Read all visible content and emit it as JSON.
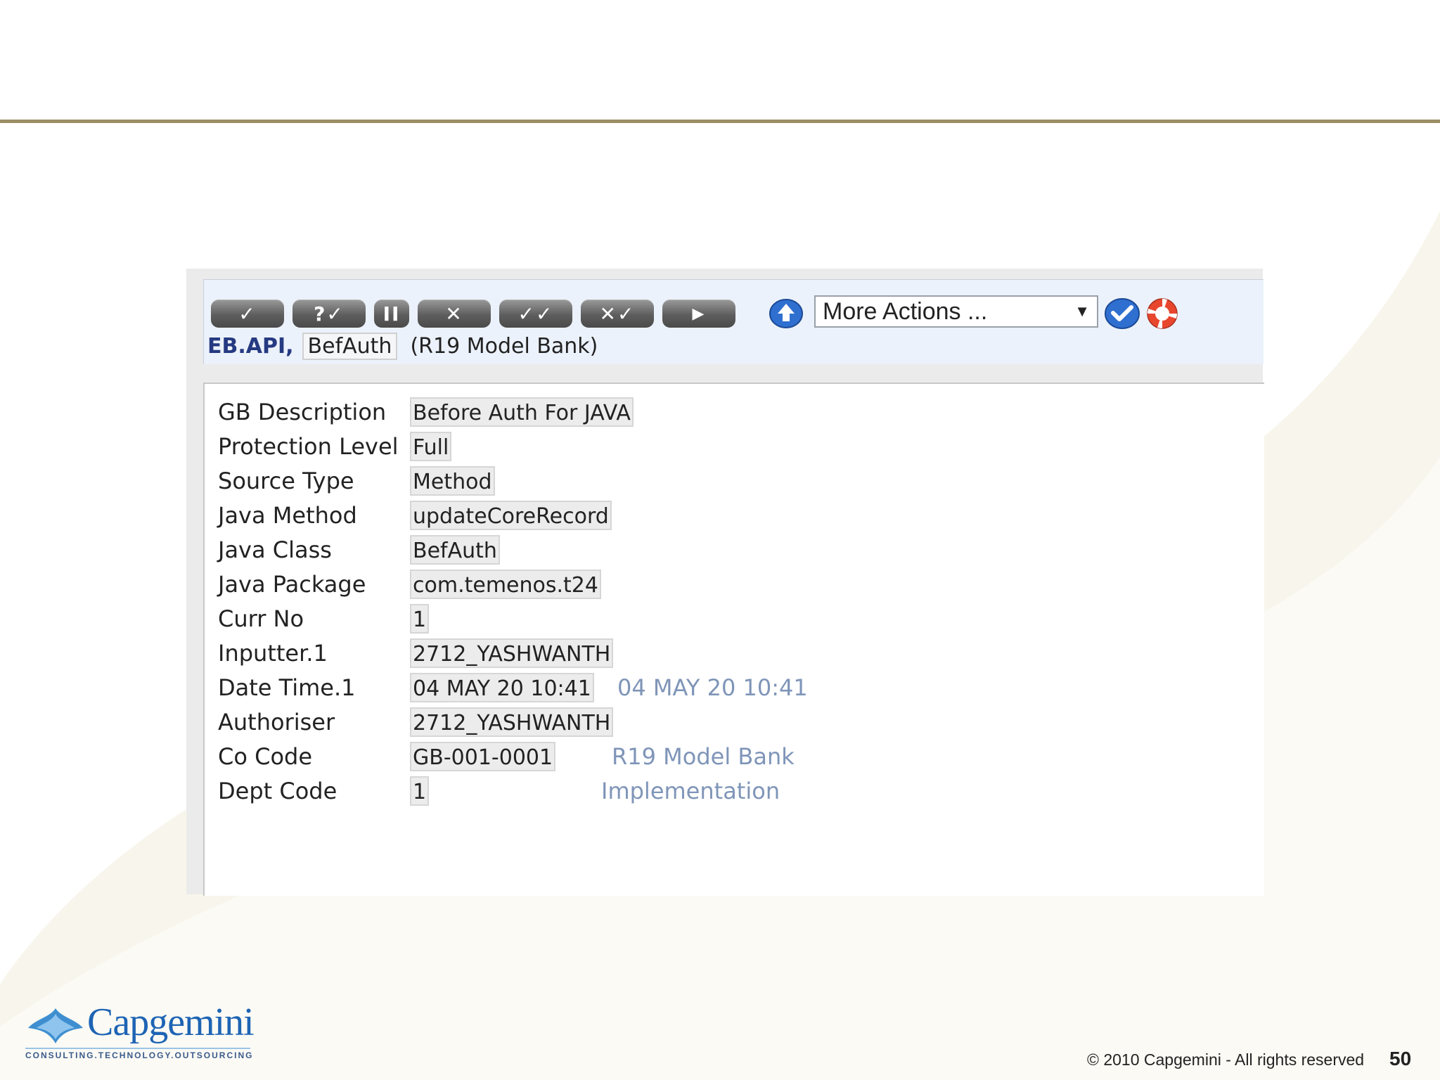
{
  "toolbar": {
    "buttons": [
      {
        "glyph": "✓",
        "icon": "validate-check-icon"
      },
      {
        "glyph": "?✓",
        "icon": "query-validate-icon"
      },
      {
        "glyph": "II",
        "icon": "hold-pause-icon"
      },
      {
        "glyph": "✕",
        "icon": "delete-x-icon"
      },
      {
        "glyph": "✓✓",
        "icon": "authorise-icon"
      },
      {
        "glyph": "✕✓",
        "icon": "reverse-icon"
      },
      {
        "glyph": "▶",
        "icon": "next-arrow-icon"
      }
    ],
    "more_actions": "More Actions ...",
    "dropdown_arrow": "▼"
  },
  "record": {
    "app": "EB.API,",
    "id": "BefAuth",
    "company": "(R19 Model Bank)"
  },
  "fields": [
    {
      "label": "GB Description",
      "value": "Before Auth For JAVA",
      "enrichment": ""
    },
    {
      "label": "Protection Level",
      "value": "Full",
      "enrichment": ""
    },
    {
      "label": "Source Type",
      "value": "Method",
      "enrichment": ""
    },
    {
      "label": "Java Method",
      "value": "updateCoreRecord",
      "enrichment": ""
    },
    {
      "label": "Java Class",
      "value": "BefAuth",
      "enrichment": ""
    },
    {
      "label": "Java Package",
      "value": "com.temenos.t24",
      "enrichment": ""
    },
    {
      "label": "Curr No",
      "value": "1",
      "enrichment": ""
    },
    {
      "label": "Inputter.1",
      "value": "2712_YASHWANTH",
      "enrichment": ""
    },
    {
      "label": "Date Time.1",
      "value": "04 MAY 20 10:41",
      "enrichment": "04 MAY 20 10:41"
    },
    {
      "label": "Authoriser",
      "value": "2712_YASHWANTH",
      "enrichment": ""
    },
    {
      "label": "Co Code",
      "value": "GB-001-0001",
      "enrichment": "R19 Model Bank"
    },
    {
      "label": "Dept Code",
      "value": "1",
      "enrichment": "Implementation"
    }
  ],
  "footer": {
    "logo_word": "Capgemini",
    "logo_tagline": "CONSULTING.TECHNOLOGY.OUTSOURCING",
    "copyright": "© 2010 Capgemini - All rights reserved",
    "page_number": "50"
  },
  "colors": {
    "rule": "#9c8f66",
    "enrichment_text": "#7f95b8",
    "app_name": "#263a82"
  }
}
